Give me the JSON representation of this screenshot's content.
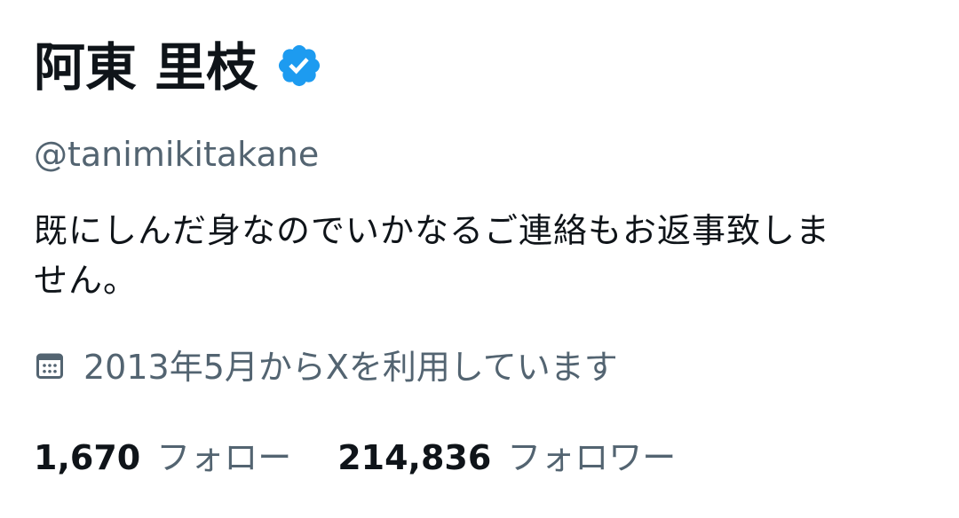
{
  "profile": {
    "display_name": "阿東 里枝",
    "verified_icon": "verified-badge-icon",
    "handle": "@tanimikitakane",
    "bio_line1": "既にしんだ身なのでいかなるご連絡もお返事致しま",
    "bio_line2": "せん。",
    "joined_icon": "calendar-icon",
    "joined_text": "2013年5月からXを利用しています",
    "following_count": "1,670",
    "following_label": "フォロー",
    "followers_count": "214,836",
    "followers_label": "フォロワー"
  },
  "colors": {
    "primary_text": "#0f1419",
    "secondary_text": "#536471",
    "verified_blue": "#1d9bf0",
    "background": "#ffffff"
  }
}
